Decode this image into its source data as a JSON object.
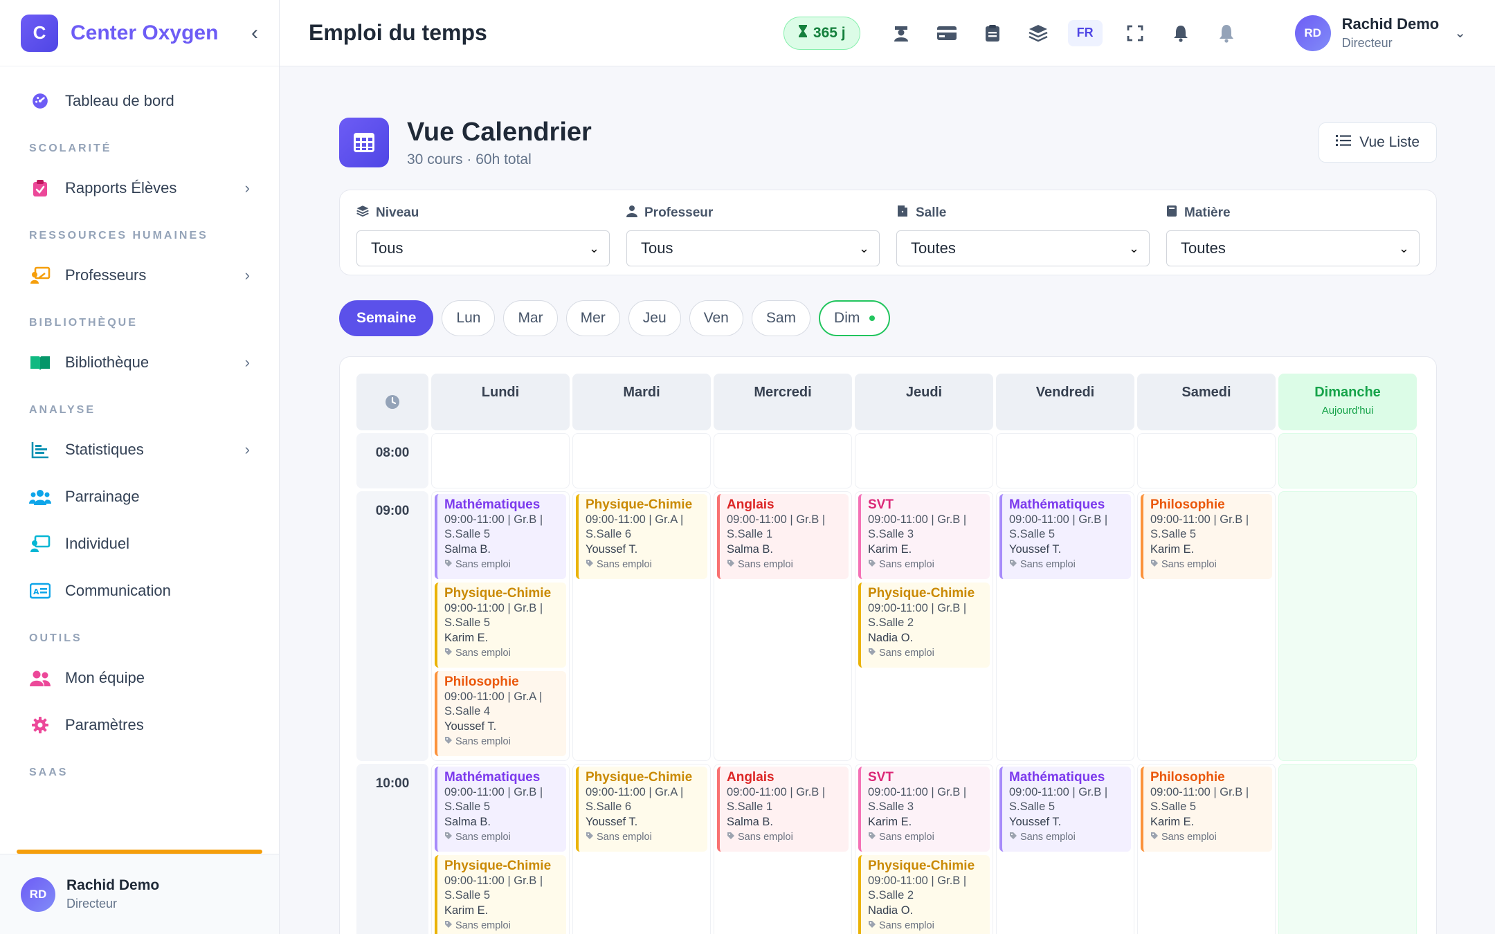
{
  "sidebar": {
    "brand_initial": "C",
    "brand_name": "Center Oxygen",
    "collapse_glyph": "‹",
    "sections": {
      "dashboard": "Tableau de bord",
      "scolarite": "SCOLARITÉ",
      "rapports": "Rapports Élèves",
      "rh": "RESSOURCES HUMAINES",
      "professeurs": "Professeurs",
      "biblio_section": "BIBLIOTHÈQUE",
      "bibliotheque": "Bibliothèque",
      "analyse": "ANALYSE",
      "statistiques": "Statistiques",
      "parrainage": "Parrainage",
      "individuel": "Individuel",
      "communication": "Communication",
      "outils": "OUTILS",
      "equipe": "Mon équipe",
      "parametres": "Paramètres",
      "saas": "SAAS"
    },
    "user": {
      "initials": "RD",
      "name": "Rachid Demo",
      "role": "Directeur"
    }
  },
  "topbar": {
    "title": "Emploi du temps",
    "days_left": "365 j",
    "lang": "FR",
    "user": {
      "initials": "RD",
      "name": "Rachid Demo",
      "role": "Directeur"
    }
  },
  "header": {
    "title": "Vue Calendrier",
    "subtitle": "30 cours · 60h total",
    "list_button": "Vue Liste"
  },
  "filters": {
    "niveau": {
      "label": "Niveau",
      "value": "Tous"
    },
    "professeur": {
      "label": "Professeur",
      "value": "Tous"
    },
    "salle": {
      "label": "Salle",
      "value": "Toutes"
    },
    "matiere": {
      "label": "Matière",
      "value": "Toutes"
    }
  },
  "day_tabs": [
    "Semaine",
    "Lun",
    "Mar",
    "Mer",
    "Jeu",
    "Ven",
    "Sam",
    "Dim"
  ],
  "grid": {
    "days": [
      "Lundi",
      "Mardi",
      "Mercredi",
      "Jeudi",
      "Vendredi",
      "Samedi",
      "Dimanche"
    ],
    "today_label": "Aujourd'hui",
    "times": [
      "08:00",
      "09:00",
      "10:00"
    ],
    "tag": "Sans emploi",
    "slot_0900": [
      [
        {
          "subject": "Mathématiques",
          "line1": "09:00-11:00 | Gr.B |",
          "line2": "S.Salle 5",
          "prof": "Salma B.",
          "color": "purple"
        },
        {
          "subject": "Physique-Chimie",
          "line1": "09:00-11:00 | Gr.B |",
          "line2": "S.Salle 5",
          "prof": "Karim E.",
          "color": "yellow"
        },
        {
          "subject": "Philosophie",
          "line1": "09:00-11:00 | Gr.A |",
          "line2": "S.Salle 4",
          "prof": "Youssef T.",
          "color": "orange"
        }
      ],
      [
        {
          "subject": "Physique-Chimie",
          "line1": "09:00-11:00 | Gr.A |",
          "line2": "S.Salle 6",
          "prof": "Youssef T.",
          "color": "yellow"
        }
      ],
      [
        {
          "subject": "Anglais",
          "line1": "09:00-11:00 | Gr.B |",
          "line2": "S.Salle 1",
          "prof": "Salma B.",
          "color": "red"
        }
      ],
      [
        {
          "subject": "SVT",
          "line1": "09:00-11:00 | Gr.B |",
          "line2": "S.Salle 3",
          "prof": "Karim E.",
          "color": "pink"
        },
        {
          "subject": "Physique-Chimie",
          "line1": "09:00-11:00 | Gr.B |",
          "line2": "S.Salle 2",
          "prof": "Nadia O.",
          "color": "yellow"
        }
      ],
      [
        {
          "subject": "Mathématiques",
          "line1": "09:00-11:00 | Gr.B |",
          "line2": "S.Salle 5",
          "prof": "Youssef T.",
          "color": "purple"
        }
      ],
      [
        {
          "subject": "Philosophie",
          "line1": "09:00-11:00 | Gr.B |",
          "line2": "S.Salle 5",
          "prof": "Karim E.",
          "color": "orange"
        }
      ],
      []
    ],
    "slot_1000": [
      [
        {
          "subject": "Mathématiques",
          "line1": "09:00-11:00 | Gr.B |",
          "line2": "S.Salle 5",
          "prof": "Salma B.",
          "color": "purple"
        },
        {
          "subject": "Physique-Chimie",
          "line1": "09:00-11:00 | Gr.B |",
          "line2": "S.Salle 5",
          "prof": "Karim E.",
          "color": "yellow"
        }
      ],
      [
        {
          "subject": "Physique-Chimie",
          "line1": "09:00-11:00 | Gr.A |",
          "line2": "S.Salle 6",
          "prof": "Youssef T.",
          "color": "yellow"
        }
      ],
      [
        {
          "subject": "Anglais",
          "line1": "09:00-11:00 | Gr.B |",
          "line2": "S.Salle 1",
          "prof": "Salma B.",
          "color": "red"
        }
      ],
      [
        {
          "subject": "SVT",
          "line1": "09:00-11:00 | Gr.B |",
          "line2": "S.Salle 3",
          "prof": "Karim E.",
          "color": "pink"
        },
        {
          "subject": "Physique-Chimie",
          "line1": "09:00-11:00 | Gr.B |",
          "line2": "S.Salle 2",
          "prof": "Nadia O.",
          "color": "yellow"
        }
      ],
      [
        {
          "subject": "Mathématiques",
          "line1": "09:00-11:00 | Gr.B |",
          "line2": "S.Salle 5",
          "prof": "Youssef T.",
          "color": "purple"
        }
      ],
      [
        {
          "subject": "Philosophie",
          "line1": "09:00-11:00 | Gr.B |",
          "line2": "S.Salle 5",
          "prof": "Karim E.",
          "color": "orange"
        }
      ],
      []
    ]
  }
}
